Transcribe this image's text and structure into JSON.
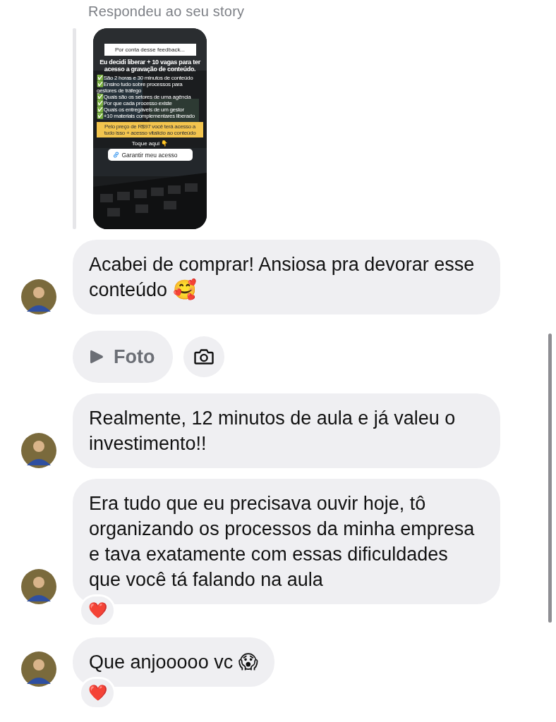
{
  "header": {
    "text": "Respondeu ao seu story"
  },
  "story": {
    "title": "Por conta desse feedback...",
    "headline": "Eu decidi liberar + 10 vagas para ter acesso a gravação de conteúdo.",
    "checklist": [
      "✅São 2 horas e 30 minutos de conteúdo",
      "✅Ensino tudo sobre processos para gestores de tráfego",
      "✅Quais são os setores de uma agência",
      "✅Por que cada processo existe",
      "✅Quais os entregáveis de um gestor",
      "✅+10 materiais complementares liberado"
    ],
    "offer": "Pelo preço de R$97 você terá acesso a tudo isso + acesso vitalício ao conteúdo",
    "hint": "Toque aqui 👇",
    "link": "Garantir meu acesso"
  },
  "messages": [
    {
      "kind": "text",
      "text": "Acabei de comprar! Ansiosa pra devorar esse conteúdo 🥰",
      "avatar": true
    },
    {
      "kind": "media",
      "label": "Foto",
      "avatar": false
    },
    {
      "kind": "text",
      "text": "Realmente, 12 minutos de aula e já valeu o investimento!!",
      "avatar": true
    },
    {
      "kind": "text",
      "text": "Era tudo que eu precisava ouvir hoje, tô organizando os processos da minha empresa e tava exatamente com essas dificuldades que você tá falando na aula",
      "avatar": true,
      "reaction": "❤️"
    },
    {
      "kind": "text",
      "text": "Que anjooooo vc 😱",
      "avatar": true,
      "reaction": "❤️"
    }
  ]
}
